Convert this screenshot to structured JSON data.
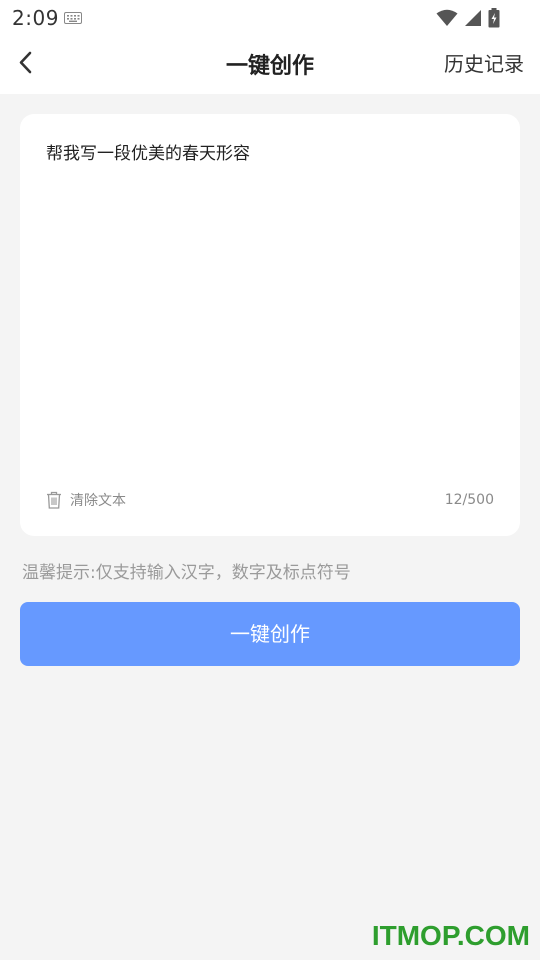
{
  "status_bar": {
    "time": "2:09",
    "icons": [
      "keyboard-icon",
      "wifi-icon",
      "signal-icon",
      "battery-charging-icon"
    ]
  },
  "header": {
    "back_icon": "chevron-left-icon",
    "title": "一键创作",
    "history_label": "历史记录"
  },
  "editor": {
    "text": "帮我写一段优美的春天形容",
    "clear_label": "清除文本",
    "clear_icon": "trash-icon",
    "char_count": "12/500"
  },
  "tip": "温馨提示:仅支持输入汉字，数字及标点符号",
  "create_button_label": "一键创作",
  "watermark": "ITMOP.COM",
  "colors": {
    "accent": "#6699ff",
    "background": "#f4f4f4",
    "watermark": "#2e9e2e"
  }
}
